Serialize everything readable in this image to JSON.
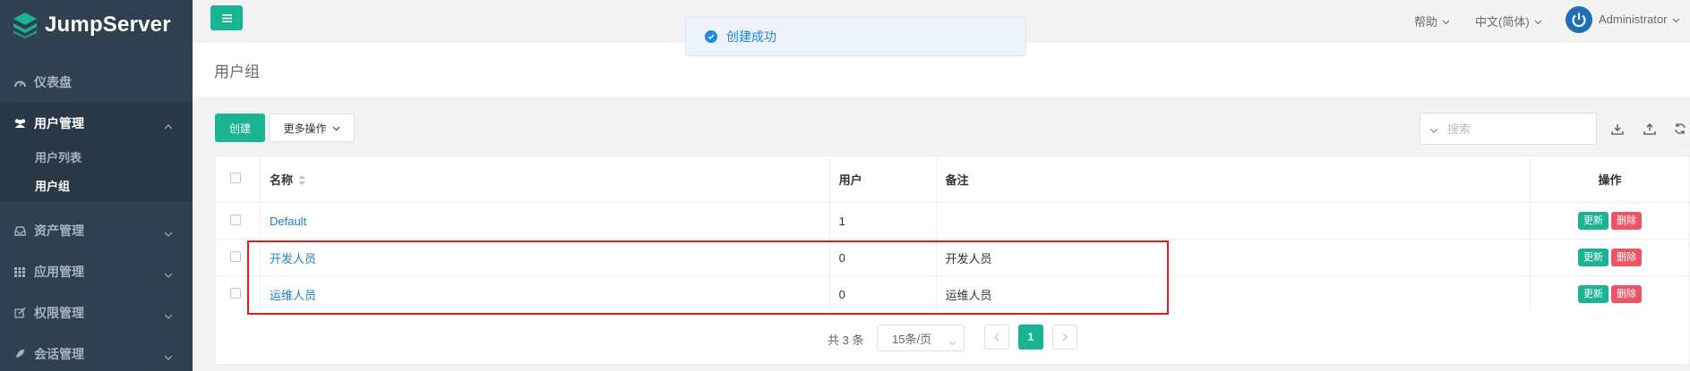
{
  "app": {
    "name": "JumpServer"
  },
  "sidebar": {
    "dashboard": "仪表盘",
    "user_mgmt": "用户管理",
    "user_list": "用户列表",
    "user_group": "用户组",
    "asset_mgmt": "资产管理",
    "app_mgmt": "应用管理",
    "perm_mgmt": "权限管理",
    "session_mgmt": "会话管理"
  },
  "topbar": {
    "help": "帮助",
    "language": "中文(简体)",
    "user": "Administrator"
  },
  "toast": {
    "message": "创建成功"
  },
  "page": {
    "title": "用户组"
  },
  "toolbar": {
    "create": "创建",
    "more_actions": "更多操作",
    "search_placeholder": "搜索"
  },
  "table": {
    "headers": {
      "name": "名称",
      "users": "用户",
      "comment": "备注",
      "actions": "操作"
    },
    "rows": [
      {
        "name": "Default",
        "users": "1",
        "comment": "",
        "update": "更新",
        "delete": "删除"
      },
      {
        "name": "开发人员",
        "users": "0",
        "comment": "开发人员",
        "update": "更新",
        "delete": "删除"
      },
      {
        "name": "运维人员",
        "users": "0",
        "comment": "运维人员",
        "update": "更新",
        "delete": "删除"
      }
    ]
  },
  "pagination": {
    "total": "共 3 条",
    "page_size": "15条/页",
    "current_page": "1"
  },
  "colors": {
    "sidebar": "#2f4050",
    "primary": "#1ab394",
    "danger": "#ed5565",
    "link": "#1c84c6",
    "highlight": "#e21b1b"
  }
}
